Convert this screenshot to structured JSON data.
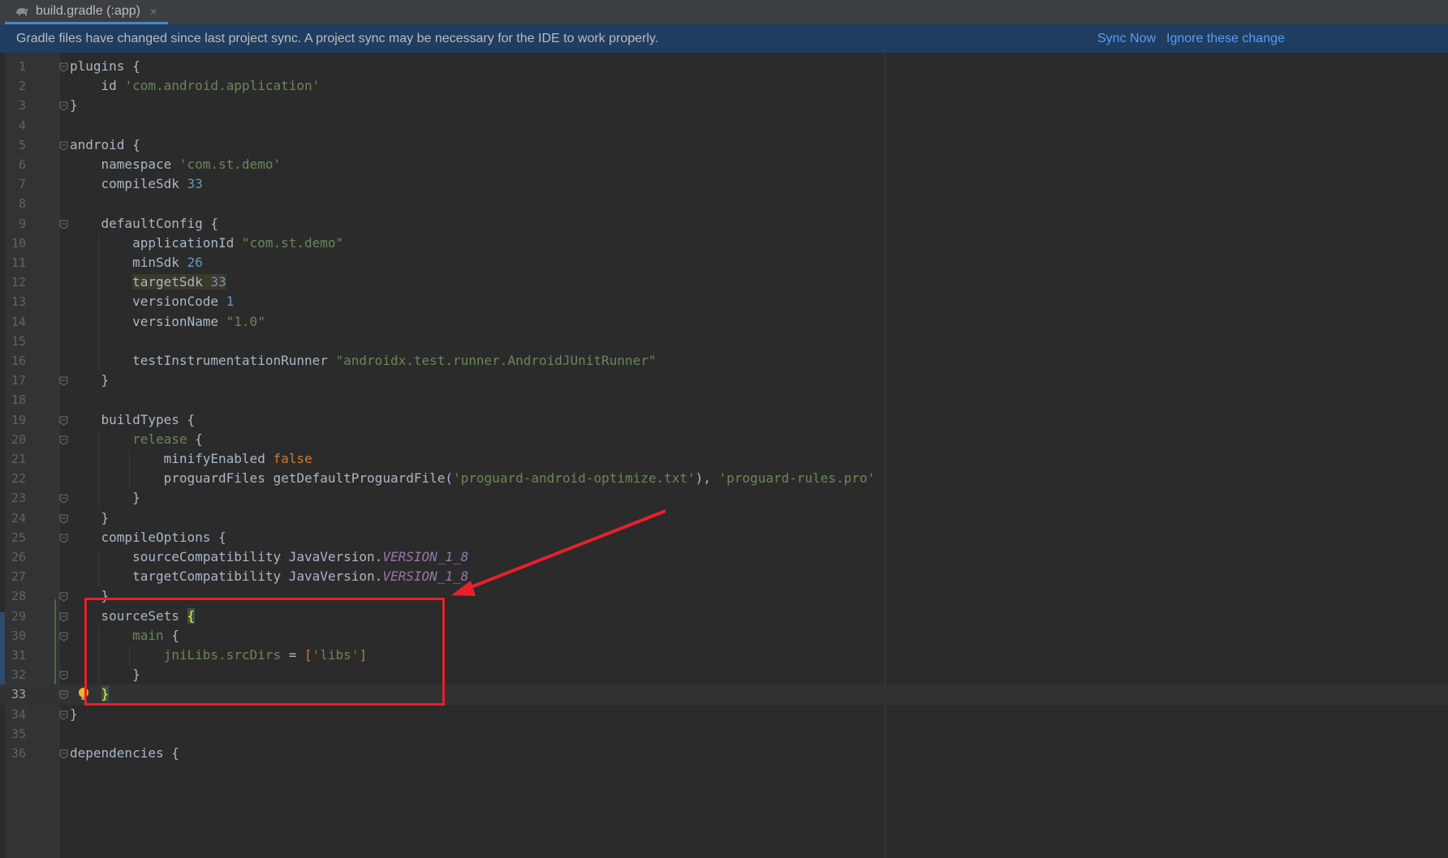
{
  "tab": {
    "title": "build.gradle (:app)",
    "close_glyph": "×",
    "icon": "gradle-elephant-icon"
  },
  "banner": {
    "message": "Gradle files have changed since last project sync. A project sync may be necessary for the IDE to work properly.",
    "sync_now": "Sync Now",
    "ignore": "Ignore these change"
  },
  "editor": {
    "current_line": 33,
    "lines": [
      {
        "n": "1",
        "tokens": [
          {
            "t": "plugins {"
          }
        ]
      },
      {
        "n": "2",
        "tokens": [
          {
            "t": "    id "
          },
          {
            "t": "'com.android.application'",
            "c": "str"
          }
        ]
      },
      {
        "n": "3",
        "tokens": [
          {
            "t": "}"
          }
        ]
      },
      {
        "n": "4",
        "tokens": []
      },
      {
        "n": "5",
        "tokens": [
          {
            "t": "android {"
          }
        ]
      },
      {
        "n": "6",
        "tokens": [
          {
            "t": "    namespace "
          },
          {
            "t": "'com.st.demo'",
            "c": "str"
          }
        ]
      },
      {
        "n": "7",
        "tokens": [
          {
            "t": "    compileSdk "
          },
          {
            "t": "33",
            "c": "num"
          }
        ]
      },
      {
        "n": "8",
        "tokens": []
      },
      {
        "n": "9",
        "tokens": [
          {
            "t": "    defaultConfig {"
          }
        ]
      },
      {
        "n": "10",
        "tokens": [
          {
            "t": "        applicationId "
          },
          {
            "t": "\"com.st.demo\"",
            "c": "str"
          }
        ]
      },
      {
        "n": "11",
        "tokens": [
          {
            "t": "        minSdk "
          },
          {
            "t": "26",
            "c": "num"
          }
        ]
      },
      {
        "n": "12",
        "tokens": [
          {
            "t": "        "
          },
          {
            "t": "targetSdk ",
            "c": "hl-target"
          },
          {
            "t": "33",
            "c": "num hl-target"
          }
        ]
      },
      {
        "n": "13",
        "tokens": [
          {
            "t": "        versionCode "
          },
          {
            "t": "1",
            "c": "num"
          }
        ]
      },
      {
        "n": "14",
        "tokens": [
          {
            "t": "        versionName "
          },
          {
            "t": "\"1.0\"",
            "c": "str"
          }
        ]
      },
      {
        "n": "15",
        "tokens": []
      },
      {
        "n": "16",
        "tokens": [
          {
            "t": "        testInstrumentationRunner "
          },
          {
            "t": "\"androidx.test.runner.AndroidJUnitRunner\"",
            "c": "str"
          }
        ]
      },
      {
        "n": "17",
        "tokens": [
          {
            "t": "    }"
          }
        ]
      },
      {
        "n": "18",
        "tokens": []
      },
      {
        "n": "19",
        "tokens": [
          {
            "t": "    buildTypes {"
          }
        ]
      },
      {
        "n": "20",
        "tokens": [
          {
            "t": "        "
          },
          {
            "t": "release",
            "c": "str"
          },
          {
            "t": " {"
          }
        ]
      },
      {
        "n": "21",
        "tokens": [
          {
            "t": "            minifyEnabled "
          },
          {
            "t": "false",
            "c": "kw"
          }
        ]
      },
      {
        "n": "22",
        "tokens": [
          {
            "t": "            proguardFiles getDefaultProguardFile("
          },
          {
            "t": "'proguard-android-optimize.txt'",
            "c": "str"
          },
          {
            "t": "), "
          },
          {
            "t": "'proguard-rules.pro'",
            "c": "str"
          }
        ]
      },
      {
        "n": "23",
        "tokens": [
          {
            "t": "        }"
          }
        ]
      },
      {
        "n": "24",
        "tokens": [
          {
            "t": "    }"
          }
        ]
      },
      {
        "n": "25",
        "tokens": [
          {
            "t": "    compileOptions {"
          }
        ]
      },
      {
        "n": "26",
        "tokens": [
          {
            "t": "        sourceCompatibility JavaVersion."
          },
          {
            "t": "VERSION_1_8",
            "c": "const"
          }
        ]
      },
      {
        "n": "27",
        "tokens": [
          {
            "t": "        targetCompatibility JavaVersion."
          },
          {
            "t": "VERSION_1_8",
            "c": "const"
          }
        ]
      },
      {
        "n": "28",
        "tokens": [
          {
            "t": "    }"
          }
        ]
      },
      {
        "n": "29",
        "tokens": [
          {
            "t": "    sourceSets "
          },
          {
            "t": "{",
            "c": "brace-hl"
          }
        ]
      },
      {
        "n": "30",
        "tokens": [
          {
            "t": "        "
          },
          {
            "t": "main",
            "c": "str"
          },
          {
            "t": " {"
          }
        ]
      },
      {
        "n": "31",
        "tokens": [
          {
            "t": "            "
          },
          {
            "t": "jniLibs.srcDirs",
            "c": "str"
          },
          {
            "t": " = "
          },
          {
            "t": "[",
            "c": "kw"
          },
          {
            "t": "'libs'",
            "c": "str"
          },
          {
            "t": "]",
            "c": "kw"
          }
        ]
      },
      {
        "n": "32",
        "tokens": [
          {
            "t": "        }"
          }
        ]
      },
      {
        "n": "33",
        "tokens": [
          {
            "t": "    "
          },
          {
            "t": "}",
            "c": "brace-hl"
          }
        ]
      },
      {
        "n": "34",
        "tokens": [
          {
            "t": "}"
          }
        ]
      },
      {
        "n": "35",
        "tokens": []
      },
      {
        "n": "36",
        "tokens": [
          {
            "t": "dependencies {"
          }
        ]
      }
    ],
    "fold_lines": [
      "1",
      "3",
      "5",
      "9",
      "17",
      "19",
      "20",
      "23",
      "24",
      "25",
      "28",
      "29",
      "30",
      "32",
      "33",
      "34",
      "36"
    ]
  },
  "annotation": {
    "box_color": "#e8202a",
    "arrow_color": "#e8202a"
  }
}
